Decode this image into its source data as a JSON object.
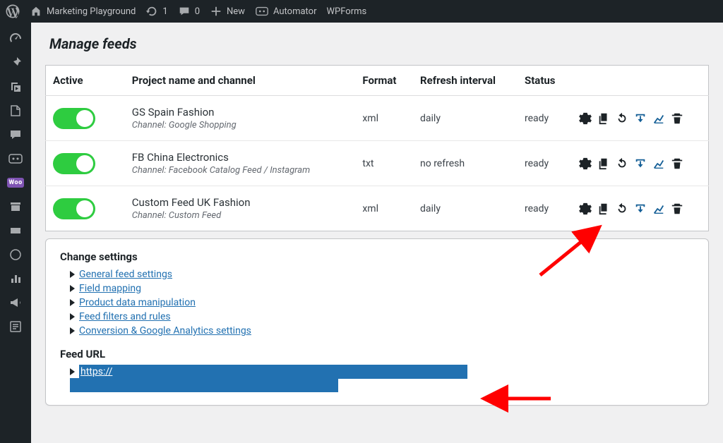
{
  "adminbar": {
    "site_name": "Marketing Playground",
    "refresh_count": "1",
    "comments_count": "0",
    "new_label": "New",
    "automator_label": "Automator",
    "wpforms_label": "WPForms"
  },
  "page_title": "Manage feeds",
  "table": {
    "headers": {
      "active": "Active",
      "project": "Project name and channel",
      "format": "Format",
      "refresh": "Refresh interval",
      "status": "Status"
    },
    "rows": [
      {
        "active": true,
        "name": "GS Spain Fashion",
        "channel": "Channel: Google Shopping",
        "format": "xml",
        "refresh": "daily",
        "status": "ready"
      },
      {
        "active": true,
        "name": "FB China Electronics",
        "channel": "Channel: Facebook Catalog Feed / Instagram",
        "format": "txt",
        "refresh": "no refresh",
        "status": "ready"
      },
      {
        "active": true,
        "name": "Custom Feed UK Fashion",
        "channel": "Channel: Custom Feed",
        "format": "xml",
        "refresh": "daily",
        "status": "ready"
      }
    ]
  },
  "settings_panel": {
    "title": "Change settings",
    "links": [
      "General feed settings",
      "Field mapping",
      "Product data manipulation",
      "Feed filters and rules",
      "Conversion & Google Analytics settings"
    ],
    "feed_url_label": "Feed URL",
    "feed_url_text": "https://"
  }
}
